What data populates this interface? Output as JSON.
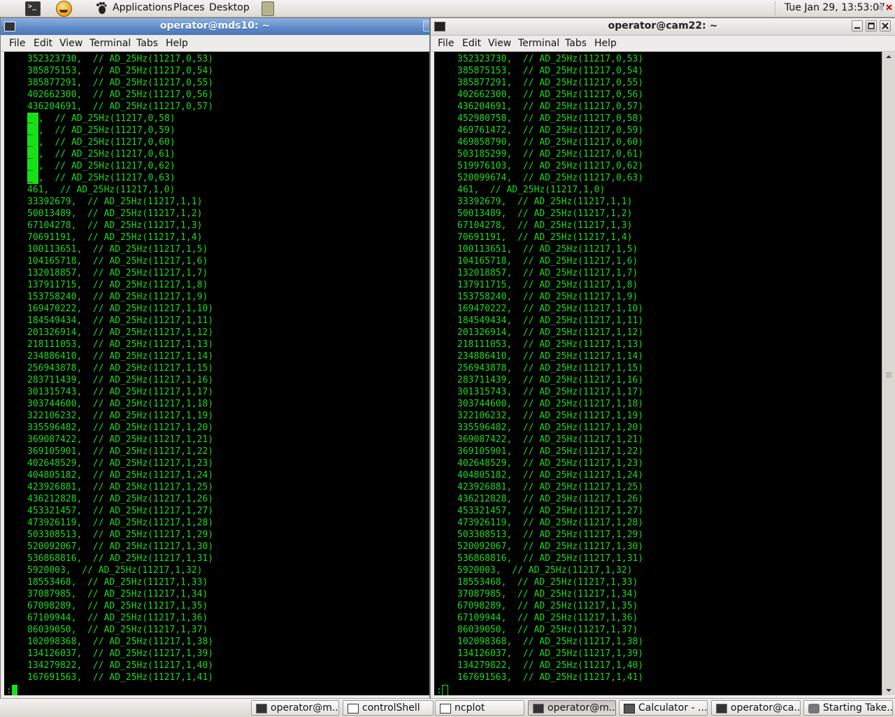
{
  "top_panel": {
    "menus": [
      "Applications",
      "Places",
      "Desktop"
    ],
    "clock": "Tue Jan 29, 13:53:07",
    "icons": [
      "terminal-icon",
      "smiley-icon",
      "gnome-foot-icon",
      "notes-icon",
      "volume-icon",
      "volume-mute-icon"
    ]
  },
  "windows": {
    "left": {
      "title": "operator@mds10: ~",
      "menu": [
        "File",
        "Edit",
        "View",
        "Terminal",
        "Tabs",
        "Help"
      ],
      "lines": [
        "352323730,  // AD_25Hz(11217,0,53)",
        "385875153,  // AD_25Hz(11217,0,54)",
        "385877291,  // AD_25Hz(11217,0,55)",
        "402662300,  // AD_25Hz(11217,0,56)",
        "436204691,  // AD_25Hz(11217,0,57)",
        "_,  // AD_25Hz(11217,0,58)",
        "_,  // AD_25Hz(11217,0,59)",
        "_,  // AD_25Hz(11217,0,60)",
        "_,  // AD_25Hz(11217,0,61)",
        "_,  // AD_25Hz(11217,0,62)",
        "_,  // AD_25Hz(11217,0,63)",
        "461,  // AD_25Hz(11217,1,0)",
        "33392679,  // AD_25Hz(11217,1,1)",
        "50013489,  // AD_25Hz(11217,1,2)",
        "67104278,  // AD_25Hz(11217,1,3)",
        "70691191,  // AD_25Hz(11217,1,4)",
        "100113651,  // AD_25Hz(11217,1,5)",
        "104165718,  // AD_25Hz(11217,1,6)",
        "132018857,  // AD_25Hz(11217,1,7)",
        "137911715,  // AD_25Hz(11217,1,8)",
        "153758240,  // AD_25Hz(11217,1,9)",
        "169470222,  // AD_25Hz(11217,1,10)",
        "184549434,  // AD_25Hz(11217,1,11)",
        "201326914,  // AD_25Hz(11217,1,12)",
        "218111053,  // AD_25Hz(11217,1,13)",
        "234886410,  // AD_25Hz(11217,1,14)",
        "256943878,  // AD_25Hz(11217,1,15)",
        "283711439,  // AD_25Hz(11217,1,16)",
        "301315743,  // AD_25Hz(11217,1,17)",
        "303744600,  // AD_25Hz(11217,1,18)",
        "322106232,  // AD_25Hz(11217,1,19)",
        "335596482,  // AD_25Hz(11217,1,20)",
        "369087422,  // AD_25Hz(11217,1,21)",
        "369105901,  // AD_25Hz(11217,1,22)",
        "402648529,  // AD_25Hz(11217,1,23)",
        "404805182,  // AD_25Hz(11217,1,24)",
        "423926881,  // AD_25Hz(11217,1,25)",
        "436212828,  // AD_25Hz(11217,1,26)",
        "453321457,  // AD_25Hz(11217,1,27)",
        "473926119,  // AD_25Hz(11217,1,28)",
        "503308513,  // AD_25Hz(11217,1,29)",
        "520092067,  // AD_25Hz(11217,1,30)",
        "536868816,  // AD_25Hz(11217,1,31)",
        "5920003,  // AD_25Hz(11217,1,32)",
        "18553468,  // AD_25Hz(11217,1,33)",
        "37087985,  // AD_25Hz(11217,1,34)",
        "67098289,  // AD_25Hz(11217,1,35)",
        "67109944,  // AD_25Hz(11217,1,36)",
        "86039050,  // AD_25Hz(11217,1,37)",
        "102098368,  // AD_25Hz(11217,1,38)",
        "134126037,  // AD_25Hz(11217,1,39)",
        "134279822,  // AD_25Hz(11217,1,40)",
        "167691563,  // AD_25Hz(11217,1,41)"
      ],
      "prompt": ":"
    },
    "right": {
      "title": "operator@cam22: ~",
      "menu": [
        "File",
        "Edit",
        "View",
        "Terminal",
        "Tabs",
        "Help"
      ],
      "lines": [
        "352323730,  // AD_25Hz(11217,0,53)",
        "385875153,  // AD_25Hz(11217,0,54)",
        "385877291,  // AD_25Hz(11217,0,55)",
        "402662300,  // AD_25Hz(11217,0,56)",
        "436204691,  // AD_25Hz(11217,0,57)",
        "452980758,  // AD_25Hz(11217,0,58)",
        "469761472,  // AD_25Hz(11217,0,59)",
        "469858790,  // AD_25Hz(11217,0,60)",
        "503185299,  // AD_25Hz(11217,0,61)",
        "519976103,  // AD_25Hz(11217,0,62)",
        "520099674,  // AD_25Hz(11217,0,63)",
        "461,  // AD_25Hz(11217,1,0)",
        "33392679,  // AD_25Hz(11217,1,1)",
        "50013489,  // AD_25Hz(11217,1,2)",
        "67104278,  // AD_25Hz(11217,1,3)",
        "70691191,  // AD_25Hz(11217,1,4)",
        "100113651,  // AD_25Hz(11217,1,5)",
        "104165718,  // AD_25Hz(11217,1,6)",
        "132018857,  // AD_25Hz(11217,1,7)",
        "137911715,  // AD_25Hz(11217,1,8)",
        "153758240,  // AD_25Hz(11217,1,9)",
        "169470222,  // AD_25Hz(11217,1,10)",
        "184549434,  // AD_25Hz(11217,1,11)",
        "201326914,  // AD_25Hz(11217,1,12)",
        "218111053,  // AD_25Hz(11217,1,13)",
        "234886410,  // AD_25Hz(11217,1,14)",
        "256943878,  // AD_25Hz(11217,1,15)",
        "283711439,  // AD_25Hz(11217,1,16)",
        "301315743,  // AD_25Hz(11217,1,17)",
        "303744600,  // AD_25Hz(11217,1,18)",
        "322106232,  // AD_25Hz(11217,1,19)",
        "335596482,  // AD_25Hz(11217,1,20)",
        "369087422,  // AD_25Hz(11217,1,21)",
        "369105901,  // AD_25Hz(11217,1,22)",
        "402648529,  // AD_25Hz(11217,1,23)",
        "404805182,  // AD_25Hz(11217,1,24)",
        "423926881,  // AD_25Hz(11217,1,25)",
        "436212828,  // AD_25Hz(11217,1,26)",
        "453321457,  // AD_25Hz(11217,1,27)",
        "473926119,  // AD_25Hz(11217,1,28)",
        "503308513,  // AD_25Hz(11217,1,29)",
        "520092067,  // AD_25Hz(11217,1,30)",
        "536868816,  // AD_25Hz(11217,1,31)",
        "5920003,  // AD_25Hz(11217,1,32)",
        "18553468,  // AD_25Hz(11217,1,33)",
        "37087985,  // AD_25Hz(11217,1,34)",
        "67098289,  // AD_25Hz(11217,1,35)",
        "67109944,  // AD_25Hz(11217,1,36)",
        "86039050,  // AD_25Hz(11217,1,37)",
        "102098368,  // AD_25Hz(11217,1,38)",
        "134126037,  // AD_25Hz(11217,1,39)",
        "134279822,  // AD_25Hz(11217,1,40)",
        "167691563,  // AD_25Hz(11217,1,41)"
      ],
      "prompt": ":"
    }
  },
  "taskbar": {
    "tasks": [
      {
        "label": "operator@m...",
        "icon": "terminal-icon",
        "active": false
      },
      {
        "label": "controlShell",
        "icon": "window-icon",
        "active": false
      },
      {
        "label": "ncplot",
        "icon": "window-icon",
        "active": false
      },
      {
        "label": "operator@m...",
        "icon": "terminal-icon",
        "active": true
      },
      {
        "label": "Calculator - ...",
        "icon": "calculator-icon",
        "active": false
      },
      {
        "label": "operator@ca...",
        "icon": "terminal-icon",
        "active": false
      },
      {
        "label": "Starting Take...",
        "icon": "camera-icon",
        "active": false
      }
    ]
  },
  "colors": {
    "terminal_fg": "#1bdc1b",
    "terminal_bg": "#000000",
    "active_title": "#5c8ac8"
  }
}
